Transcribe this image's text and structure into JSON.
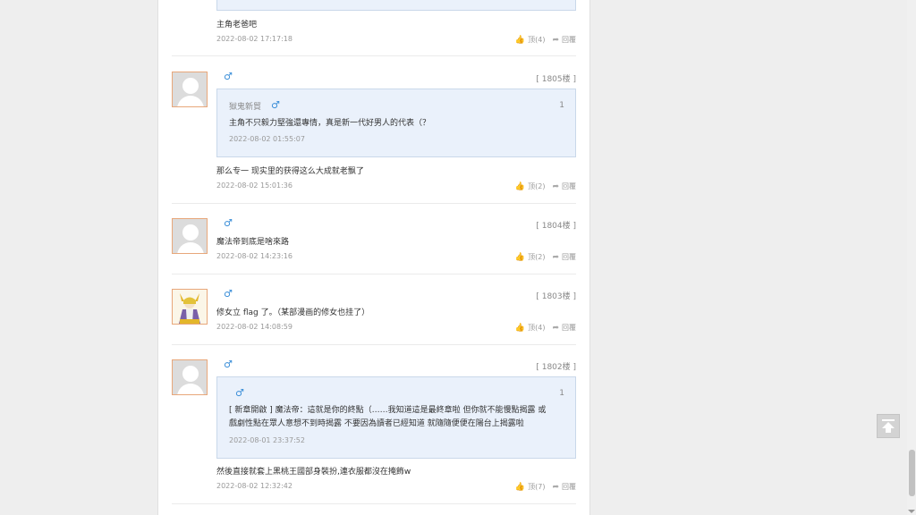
{
  "actions": {
    "reply_label": "回覆"
  },
  "top_item": {
    "text": "主角老爸吧",
    "time": "2022-08-02 17:17:18",
    "likes": "顶(4)"
  },
  "comments": [
    {
      "floor": "[ 1805楼 ]",
      "quote_name": "獄鬼新貿",
      "quote_num": "1",
      "quote_text": "主角不只毅力堅強還專情，真是新一代好男人的代表（？",
      "quote_time": "2022-08-02 01:55:07",
      "text": "那么专一 现实里的获得这么大成就老飘了",
      "time": "2022-08-02 15:01:36",
      "likes": "顶(2)"
    },
    {
      "floor": "[ 1804楼 ]",
      "text": "魔法帝到底是啥來路",
      "time": "2022-08-02 14:23:16",
      "likes": "顶(2)"
    },
    {
      "floor": "[ 1803楼 ]",
      "text": "修女立 flag 了。（某部漫画的修女也挂了）",
      "time": "2022-08-02 14:08:59",
      "likes": "顶(4)"
    },
    {
      "floor": "[ 1802楼 ]",
      "quote_num": "1",
      "quote_text_1": "[ 新章開啟 ] 魔法帝：這就是你的終點（……我知道這是最終章啦 但你就不能慢點揭露 或",
      "quote_text_2": "戲劇性點在眾人意想不到時揭露 不要因為讀者已經知道 就隨隨便便在陽台上揭露啦",
      "quote_time": "2022-08-01 23:37:52",
      "text": "然後直接就套上黑桃王國部身裝扮,連衣服都沒在掩飾w",
      "time": "2022-08-02 12:32:42",
      "likes": "顶(7)"
    }
  ],
  "colors": {
    "male": "#3a8ed8",
    "quote_bg": "#eaf1fb",
    "avatar_border": "#e8a77a"
  }
}
